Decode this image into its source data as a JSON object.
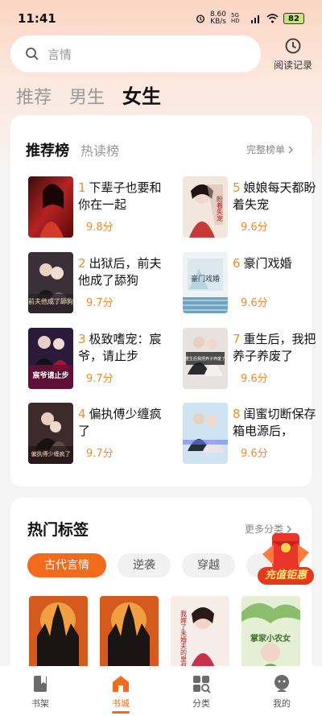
{
  "status": {
    "time": "11:41",
    "net_speed": "8.60",
    "net_unit": "KB/s",
    "signal": "5G HD",
    "battery": "82"
  },
  "search": {
    "placeholder": "言情"
  },
  "history": {
    "label": "阅读记录"
  },
  "top_tabs": [
    {
      "label": "推荐",
      "active": false
    },
    {
      "label": "男生",
      "active": false
    },
    {
      "label": "女生",
      "active": true
    }
  ],
  "ranking": {
    "title": "推荐榜",
    "subtab": "热读榜",
    "more": "完整榜单",
    "books": [
      {
        "rank": "1",
        "title": "下辈子也要和你在一起",
        "score": "9.8分"
      },
      {
        "rank": "2",
        "title": "出狱后，前夫他成了舔狗",
        "score": "9.7分"
      },
      {
        "rank": "3",
        "title": "极致嗜宠：宸爷，请止步",
        "score": "9.7分"
      },
      {
        "rank": "4",
        "title": "偏执傅少缠疯了",
        "score": "9.7分"
      },
      {
        "rank": "5",
        "title": "娘娘每天都盼着失宠",
        "score": "9.6分"
      },
      {
        "rank": "6",
        "title": "豪门戏婚",
        "score": "9.6分"
      },
      {
        "rank": "7",
        "title": "重生后，我把养子养废了",
        "score": "9.6分"
      },
      {
        "rank": "8",
        "title": "闺蜜切断保存箱电源后，",
        "score": "9.6分"
      }
    ],
    "cover_texts": [
      "",
      "前夫他成了舔狗",
      "宸爷请止步",
      "偏执傅少缠疯了",
      "盼着失宠",
      "豪门戏婚",
      "重生后我把养子养废了",
      ""
    ]
  },
  "tags": {
    "title": "热门标签",
    "more": "更多分类",
    "items": [
      {
        "label": "古代言情",
        "active": true
      },
      {
        "label": "逆袭",
        "active": false
      },
      {
        "label": "穿越",
        "active": false
      }
    ],
    "cover_texts": [
      "",
      "",
      "我嫁了未婚夫的皇叔",
      "掌家小农女"
    ]
  },
  "promo": {
    "label": "充值钜惠"
  },
  "nav": [
    {
      "label": "书架",
      "icon": "bookshelf-icon",
      "active": false
    },
    {
      "label": "书城",
      "icon": "bookstore-icon",
      "active": true
    },
    {
      "label": "分类",
      "icon": "category-icon",
      "active": false
    },
    {
      "label": "我的",
      "icon": "profile-icon",
      "active": false
    }
  ],
  "colors": {
    "accent": "#f26a1b",
    "score": "#f08a24"
  }
}
